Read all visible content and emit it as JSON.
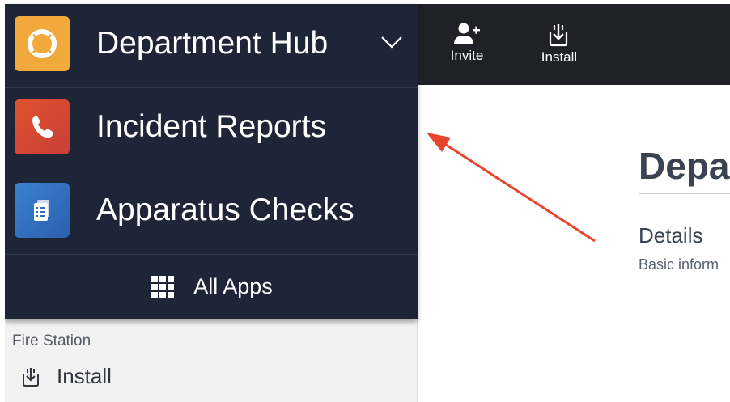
{
  "toolbar": {
    "invite_label": "Invite",
    "install_label": "Install"
  },
  "menu": {
    "current_app": "Department Hub",
    "items": [
      {
        "label": "Incident Reports",
        "icon": "phone-icon",
        "color": "#d8482e"
      },
      {
        "label": "Apparatus Checks",
        "icon": "clipboard-icon",
        "color": "#2f6fbf"
      }
    ],
    "all_apps_label": "All Apps",
    "current_app_color": "#f2a93b"
  },
  "sidebar": {
    "section_label": "Fire Station",
    "install_label": "Install"
  },
  "main": {
    "title": "Depar",
    "subtitle": "Details",
    "description": "Basic inform"
  },
  "annotation": {
    "arrow_color": "#e8452f"
  }
}
